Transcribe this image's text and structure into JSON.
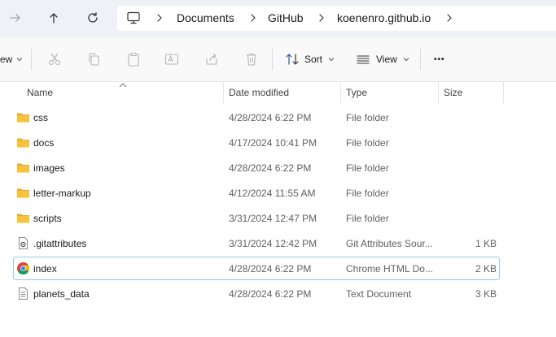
{
  "breadcrumb": [
    "Documents",
    "GitHub",
    "koenenro.github.io"
  ],
  "toolbar": {
    "view_left_label": "ew",
    "sort_label": "Sort",
    "view_label": "View",
    "more_label": "•••"
  },
  "columns": {
    "name": "Name",
    "date": "Date modified",
    "type": "Type",
    "size": "Size"
  },
  "files": [
    {
      "name": "css",
      "date": "4/28/2024 6:22 PM",
      "type": "File folder",
      "size": "",
      "icon": "folder-icon"
    },
    {
      "name": "docs",
      "date": "4/17/2024 10:41 PM",
      "type": "File folder",
      "size": "",
      "icon": "folder-icon"
    },
    {
      "name": "images",
      "date": "4/28/2024 6:22 PM",
      "type": "File folder",
      "size": "",
      "icon": "folder-icon"
    },
    {
      "name": "letter-markup",
      "date": "4/12/2024 11:55 AM",
      "type": "File folder",
      "size": "",
      "icon": "folder-icon"
    },
    {
      "name": "scripts",
      "date": "3/31/2024 12:47 PM",
      "type": "File folder",
      "size": "",
      "icon": "folder-icon"
    },
    {
      "name": ".gitattributes",
      "date": "3/31/2024 12:42 PM",
      "type": "Git Attributes Sour...",
      "size": "1 KB",
      "icon": "config-file-icon"
    },
    {
      "name": "index",
      "date": "4/28/2024 6:22 PM",
      "type": "Chrome HTML Do...",
      "size": "2 KB",
      "icon": "chrome-icon",
      "selected": true
    },
    {
      "name": "planets_data",
      "date": "4/28/2024 6:22 PM",
      "type": "Text Document",
      "size": "3 KB",
      "icon": "text-file-icon"
    }
  ],
  "colors": {
    "addressbar_bg": "#eef2f7",
    "folder_yellow": "#f7c33b",
    "selection_border": "#99c9ef"
  }
}
